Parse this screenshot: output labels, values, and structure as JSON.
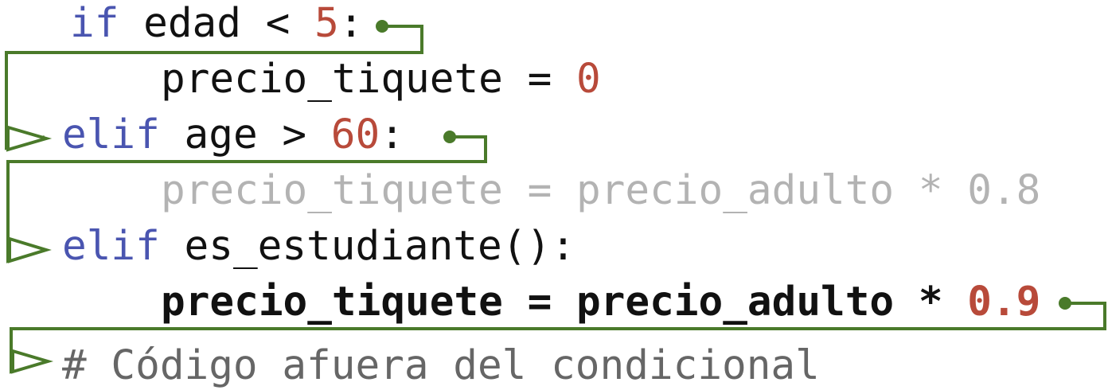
{
  "code": {
    "line1": {
      "keyword": "if",
      "text": " edad < ",
      "number": "5",
      "end": ":"
    },
    "line2": {
      "indent": "    ",
      "text": "precio_tiquete = ",
      "number": "0"
    },
    "line3": {
      "keyword": "elif",
      "text": " age > ",
      "number": "60",
      "end": ":"
    },
    "line4": {
      "indent": "    ",
      "text": "precio_tiquete = precio_adulto * 0.8"
    },
    "line5": {
      "keyword": "elif",
      "text": " es_estudiante():"
    },
    "line6": {
      "indent": "    ",
      "text": "precio_tiquete = precio_adulto * ",
      "number": "0.9"
    },
    "line7": {
      "text": "# Código afuera del condicional"
    }
  },
  "colors": {
    "keyword": "#4a55b0",
    "number": "#b84a3a",
    "flow_arrow": "#4a7a2a",
    "inactive_code": "#b3b3b3",
    "comment": "#666666"
  }
}
